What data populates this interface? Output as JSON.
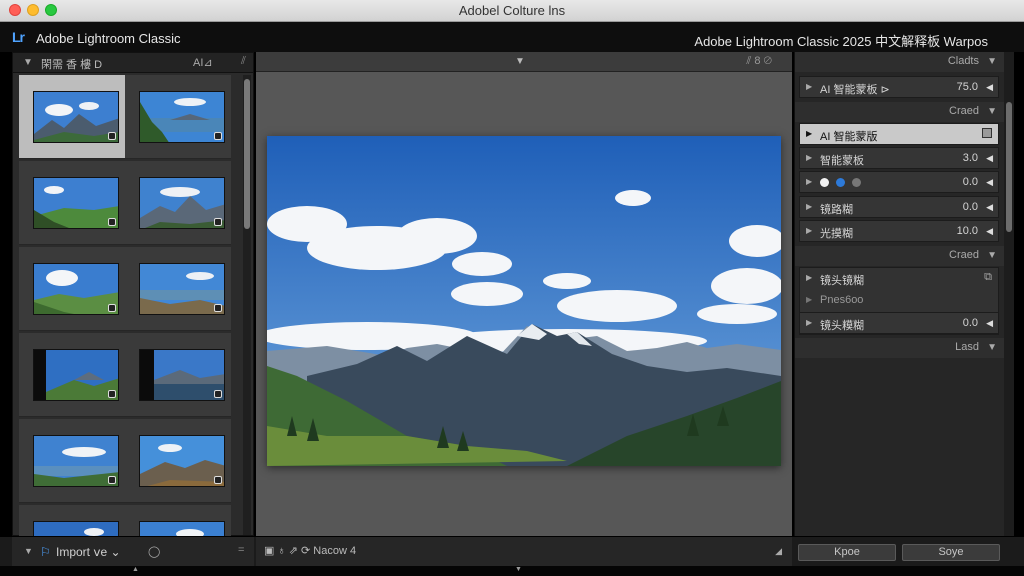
{
  "window": {
    "title": "Adobel Colture lns"
  },
  "app": {
    "logo": "Lr",
    "name": "Adobe Lightroom Classic",
    "right_title": "Adobe Lightroom Classic 2025 中文解释板 Warpos"
  },
  "left_panel": {
    "header_label": "閑需 香 樓 D",
    "header_right": "AI⊿",
    "header_small": "⫽"
  },
  "center_panel": {
    "header_tools": "⫽ 8  ⊘",
    "toolbar": "▣  ♁  ⇗  ⟳ Nacow 4"
  },
  "right_panel": {
    "sections": {
      "s1": "Cladts",
      "s2": "Craed",
      "s3": "Craed",
      "s4": "Lasd"
    },
    "rows": {
      "ai_mask_top": {
        "name": "AI 智能蒙板 ⊳",
        "value": "75.0"
      },
      "ai_mask_active": {
        "name": "AI 智能蒙版"
      },
      "smart_panel": {
        "name": "智能蒙板",
        "value": "3.0"
      },
      "colors_row": {
        "value": "0.0"
      },
      "lens_blur": {
        "name": "镜路糊",
        "value": "0.0"
      },
      "light_blur": {
        "name": "光摸糊",
        "value": "10.0"
      },
      "lens_blur_group_title": {
        "name": "镜头镜糊"
      },
      "lens_blur_group_sub": {
        "name": "Pnes6oo"
      },
      "lens_blur_group_row": {
        "name": "镜头糢糊",
        "value": "0.0"
      }
    }
  },
  "bottom": {
    "import_label": "Import ⅴe  ⌄",
    "btn_a": "Kpoe",
    "btn_b": "Soye"
  },
  "colors": {
    "accent": "#4fa3ff",
    "panel": "#2b2b2b",
    "selected": "#bdbdbd"
  }
}
